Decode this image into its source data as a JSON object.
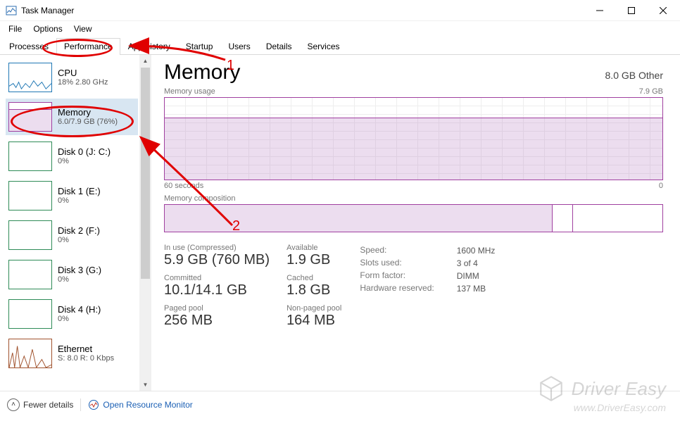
{
  "window": {
    "title": "Task Manager"
  },
  "menu": {
    "file": "File",
    "options": "Options",
    "view": "View"
  },
  "tabs": {
    "processes": "Processes",
    "performance": "Performance",
    "app_history": "App history",
    "startup": "Startup",
    "users": "Users",
    "details": "Details",
    "services": "Services"
  },
  "sidebar": {
    "cpu": {
      "name": "CPU",
      "sub": "18%  2.80 GHz"
    },
    "memory": {
      "name": "Memory",
      "sub": "6.0/7.9 GB (76%)"
    },
    "disk0": {
      "name": "Disk 0 (J: C:)",
      "sub": "0%"
    },
    "disk1": {
      "name": "Disk 1 (E:)",
      "sub": "0%"
    },
    "disk2": {
      "name": "Disk 2 (F:)",
      "sub": "0%"
    },
    "disk3": {
      "name": "Disk 3 (G:)",
      "sub": "0%"
    },
    "disk4": {
      "name": "Disk 4 (H:)",
      "sub": "0%"
    },
    "ethernet": {
      "name": "Ethernet",
      "sub": "S: 8.0  R: 0 Kbps"
    }
  },
  "detail": {
    "title": "Memory",
    "right_text": "8.0 GB Other",
    "usage_label": "Memory usage",
    "usage_max": "7.9 GB",
    "time_left": "60 seconds",
    "time_right": "0",
    "comp_label": "Memory composition",
    "stats": {
      "inuse_label": "In use (Compressed)",
      "inuse_value": "5.9 GB (760 MB)",
      "available_label": "Available",
      "available_value": "1.9 GB",
      "committed_label": "Committed",
      "committed_value": "10.1/14.1 GB",
      "cached_label": "Cached",
      "cached_value": "1.8 GB",
      "paged_label": "Paged pool",
      "paged_value": "256 MB",
      "nonpaged_label": "Non-paged pool",
      "nonpaged_value": "164 MB"
    },
    "meta": {
      "speed_label": "Speed:",
      "speed_value": "1600 MHz",
      "slots_label": "Slots used:",
      "slots_value": "3 of 4",
      "form_label": "Form factor:",
      "form_value": "DIMM",
      "hw_label": "Hardware reserved:",
      "hw_value": "137 MB"
    }
  },
  "bottom": {
    "fewer": "Fewer details",
    "resmon": "Open Resource Monitor"
  },
  "annotations": {
    "num1": "1",
    "num2": "2"
  },
  "watermark": {
    "brand": "Driver Easy",
    "url": "www.DriverEasy.com"
  }
}
